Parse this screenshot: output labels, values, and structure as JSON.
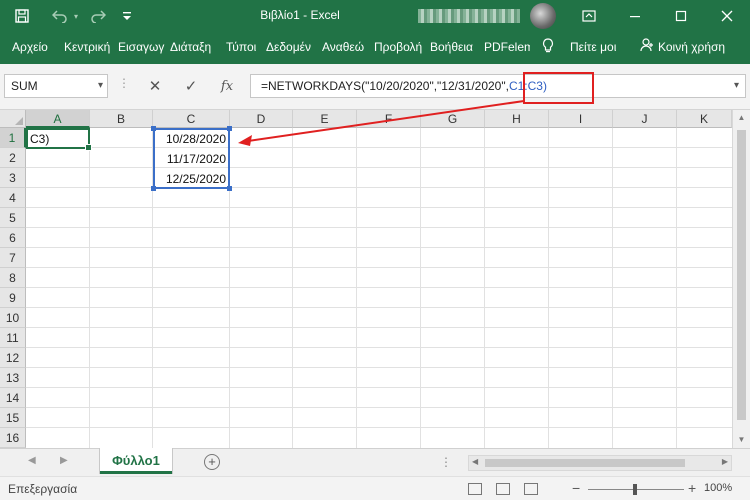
{
  "window": {
    "title": "Βιβλίο1  -  Excel",
    "quick_access": [
      "save-icon",
      "undo-icon",
      "redo-icon",
      "customize-icon"
    ],
    "controls": [
      "minimize-icon",
      "maximize-icon",
      "close-icon",
      "ribbon-display-icon"
    ]
  },
  "ribbon": {
    "tabs": [
      "Αρχείο",
      "Κεντρική",
      "Εισαγωγ",
      "Διάταξη",
      "Τύποι",
      "Δεδομέν",
      "Αναθεώ",
      "Προβολή",
      "Βοήθεια",
      "PDFelem"
    ],
    "tell_me": "Πείτε μοι",
    "share": "Κοινή χρήση"
  },
  "formula_bar": {
    "name_box": "SUM",
    "formula_prefix": "=NETWORKDAYS(\"10/20/2020\",\"12/31/2020\",",
    "formula_ref": "C1:C3)",
    "buttons": {
      "cancel": "✕",
      "enter": "✓",
      "function": "fx"
    }
  },
  "grid": {
    "columns": [
      "A",
      "B",
      "C",
      "D",
      "E",
      "F",
      "G",
      "H",
      "I",
      "J",
      "K"
    ],
    "rows": [
      "1",
      "2",
      "3",
      "4",
      "5",
      "6",
      "7",
      "8",
      "9",
      "10",
      "11",
      "12",
      "13",
      "14",
      "15",
      "16"
    ],
    "active_cell": "A1",
    "active_cell_text": "C3)",
    "cells": [
      {
        "ref": "C1",
        "value": "10/28/2020"
      },
      {
        "ref": "C2",
        "value": "11/17/2020"
      },
      {
        "ref": "C3",
        "value": "12/25/2020"
      }
    ],
    "reference_range": "C1:C3"
  },
  "sheets": {
    "tabs": [
      "Φύλλο1"
    ],
    "active": "Φύλλο1",
    "add_label": "+"
  },
  "status_bar": {
    "mode": "Επεξεργασία",
    "zoom_minus": "−",
    "zoom_plus": "+",
    "zoom": "100%"
  },
  "colors": {
    "excel_green": "#217346",
    "ref_blue": "#3b6fc8",
    "annotation_red": "#e02020"
  }
}
